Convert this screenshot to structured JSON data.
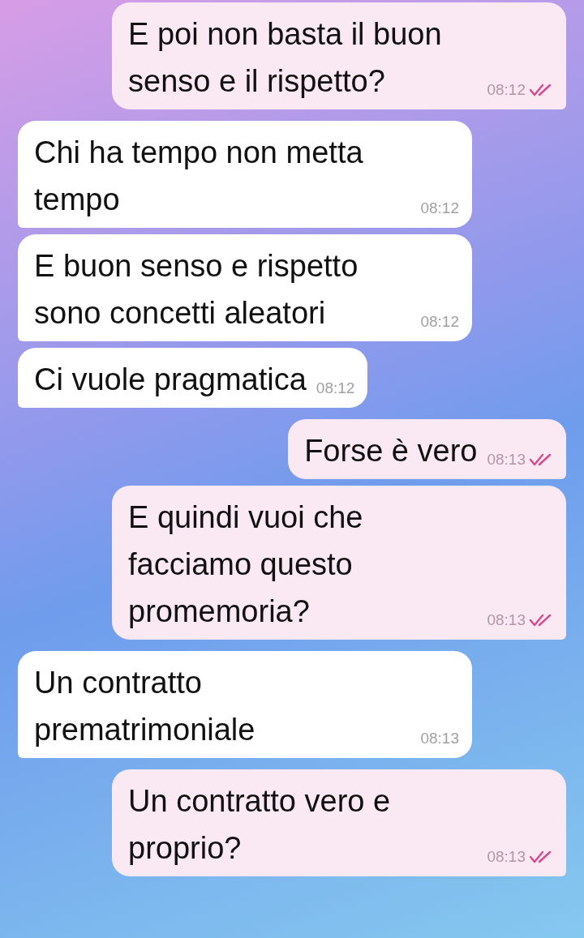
{
  "messages": [
    {
      "kind": "outgoing",
      "text": "E poi non basta il buon senso e il rispetto?",
      "time": "08:12",
      "read": true
    },
    {
      "kind": "incoming",
      "text": "Chi ha tempo non metta tempo",
      "time": "08:12"
    },
    {
      "kind": "incoming",
      "text": "E buon senso e rispetto sono concetti aleatori",
      "time": "08:12"
    },
    {
      "kind": "incoming",
      "text": "Ci vuole pragmatica",
      "time": "08:12"
    },
    {
      "kind": "outgoing",
      "text": "Forse è vero",
      "time": "08:13",
      "read": true
    },
    {
      "kind": "outgoing",
      "text": "E quindi vuoi che facciamo questo promemoria?",
      "time": "08:13",
      "read": true
    },
    {
      "kind": "incoming",
      "text": "Un contratto prematrimoniale",
      "time": "08:13"
    },
    {
      "kind": "outgoing",
      "text": "Un contratto vero e proprio?",
      "time": "08:13",
      "read": true
    }
  ]
}
